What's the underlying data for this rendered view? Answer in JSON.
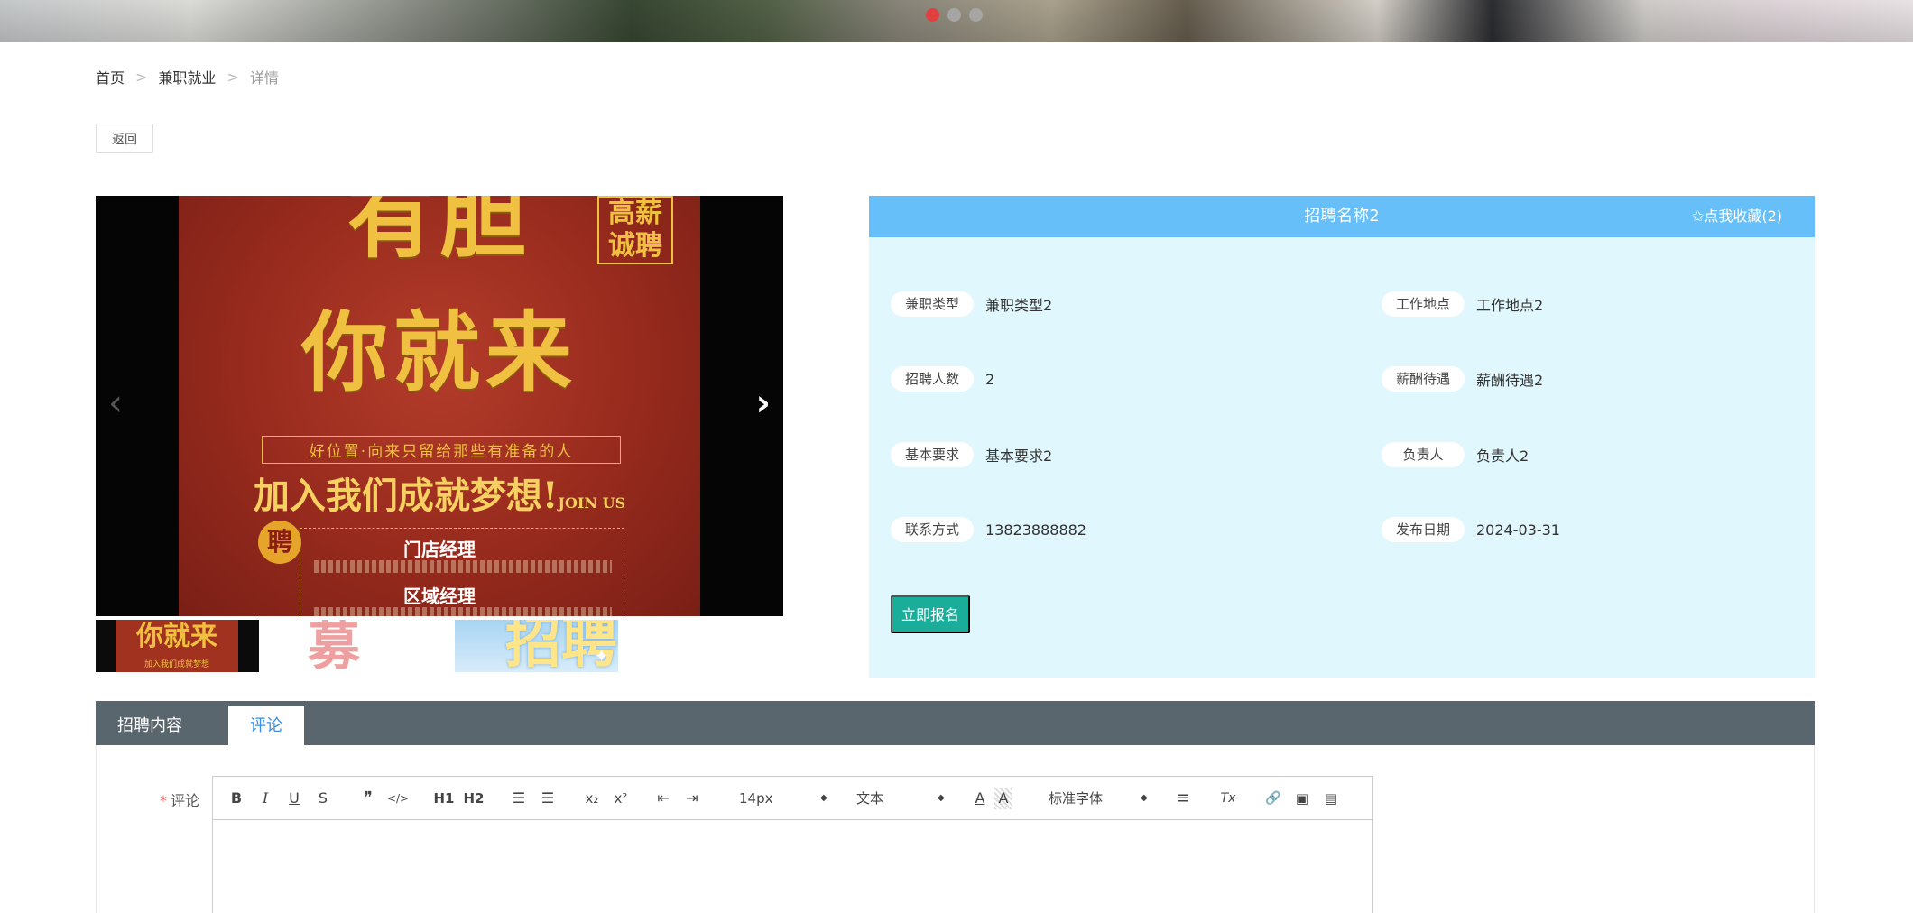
{
  "banner": {
    "slide_count": 3,
    "active_slide": 1
  },
  "breadcrumb": {
    "home": "首页",
    "section": "兼职就业",
    "current": "详情",
    "separator": ">"
  },
  "back_label": "返回",
  "gallery": {
    "poster": {
      "top_text": "有胆",
      "badge": "高薪诚聘",
      "main_text": "你就来",
      "slogan": "好位置·向来只留给那些有准备的人",
      "join_text": "加入我们成就梦想!",
      "join_en": "JOIN US",
      "seal": "聘",
      "role_1": "门店经理",
      "role_2": "区域经理"
    },
    "thumb_1_text": "你就来",
    "thumb_1_sub": "加入我们成就梦想",
    "thumb_2_text": "募",
    "thumb_3_text": "招聘",
    "prev_icon": "chevron-left-icon",
    "next_icon": "chevron-right-icon"
  },
  "job": {
    "title": "招聘名称2",
    "favorite_label": "✩点我收藏(2)",
    "fields": [
      {
        "label": "兼职类型",
        "value": "兼职类型2"
      },
      {
        "label": "工作地点",
        "value": "工作地点2"
      },
      {
        "label": "招聘人数",
        "value": "2"
      },
      {
        "label": "薪酬待遇",
        "value": "薪酬待遇2"
      },
      {
        "label": "基本要求",
        "value": "基本要求2"
      },
      {
        "label": "负责人",
        "value": "负责人2"
      },
      {
        "label": "联系方式",
        "value": "13823888882"
      },
      {
        "label": "发布日期",
        "value": "2024-03-31"
      }
    ],
    "apply_label": "立即报名"
  },
  "tabs": [
    {
      "label": "招聘内容",
      "active": false
    },
    {
      "label": "评论",
      "active": true
    }
  ],
  "comment": {
    "required_mark": "*",
    "label": "评论",
    "toolbar": {
      "bold": "B",
      "italic": "I",
      "underline": "U",
      "strike": "S",
      "quote": "❞",
      "code": "</>",
      "h1": "H1",
      "h2": "H2",
      "ordered_list": "☰",
      "bullet_list": "☰",
      "subscript": "x₂",
      "superscript": "x²",
      "outdent": "⇤",
      "indent": "⇥",
      "size": "14px",
      "format": "文本",
      "color": "A",
      "background": "A",
      "font": "标准字体",
      "align": "≡",
      "clean": "Tx",
      "link": "🔗",
      "image": "▣",
      "video": "▤"
    },
    "colors": {
      "accent": "#3a8ee6",
      "header": "#66bff9",
      "panel": "#e0f7fd",
      "apply": "#1aae9a",
      "tabbar": "#59666e"
    }
  }
}
